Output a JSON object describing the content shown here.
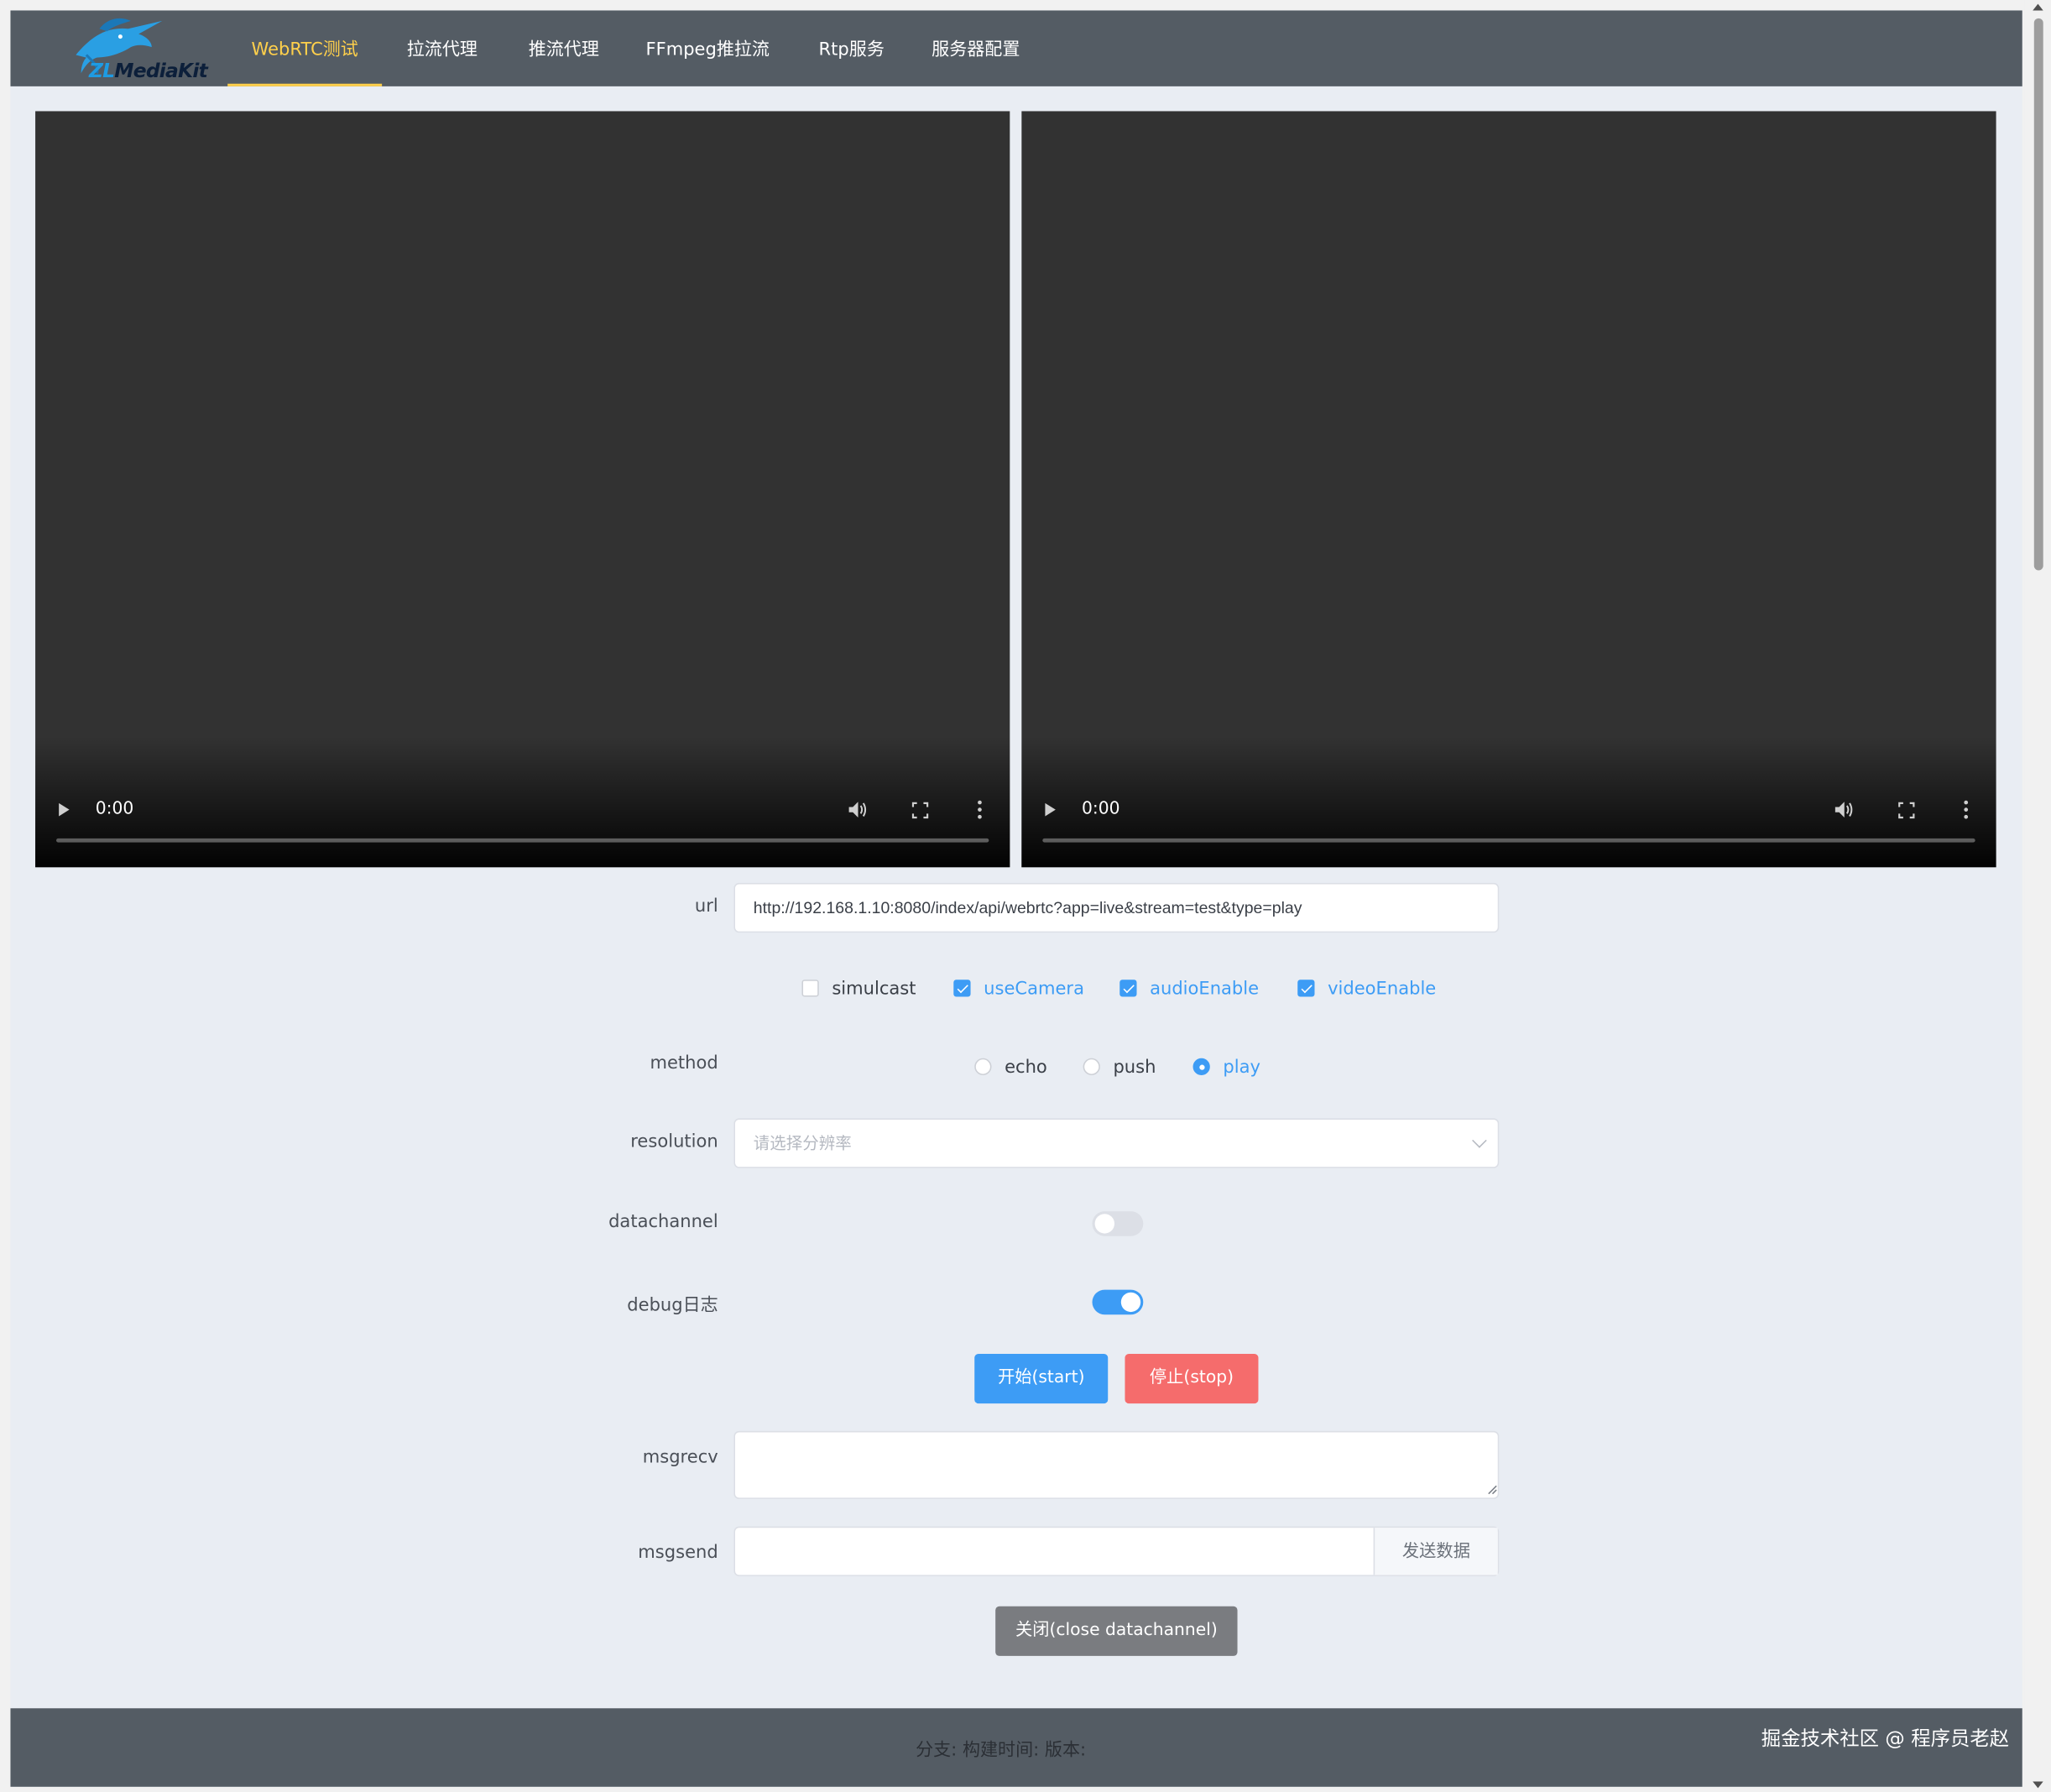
{
  "header": {
    "logo_text_prefix": "ZL",
    "logo_text_suffix": "MediaKit",
    "nav": [
      {
        "label": "WebRTC测试",
        "active": true
      },
      {
        "label": "拉流代理",
        "active": false
      },
      {
        "label": "推流代理",
        "active": false
      },
      {
        "label": "FFmpeg推拉流",
        "active": false
      },
      {
        "label": "Rtp服务",
        "active": false
      },
      {
        "label": "服务器配置",
        "active": false
      }
    ]
  },
  "videos": [
    {
      "time": "0:00"
    },
    {
      "time": "0:00"
    }
  ],
  "form": {
    "url_label": "url",
    "url_value": "http://192.168.1.10:8080/index/api/webrtc?app=live&stream=test&type=play",
    "checkboxes": [
      {
        "label": "simulcast",
        "checked": false
      },
      {
        "label": "useCamera",
        "checked": true
      },
      {
        "label": "audioEnable",
        "checked": true
      },
      {
        "label": "videoEnable",
        "checked": true
      }
    ],
    "method_label": "method",
    "methods": [
      {
        "label": "echo",
        "selected": false
      },
      {
        "label": "push",
        "selected": false
      },
      {
        "label": "play",
        "selected": true
      }
    ],
    "resolution_label": "resolution",
    "resolution_placeholder": "请选择分辨率",
    "datachannel_label": "datachannel",
    "datachannel_on": false,
    "debug_label": "debug日志",
    "debug_on": true,
    "start_button": "开始(start)",
    "stop_button": "停止(stop)",
    "msgrecv_label": "msgrecv",
    "msgrecv_value": "",
    "msgsend_label": "msgsend",
    "msgsend_value": "",
    "send_button": "发送数据",
    "close_button": "关闭(close datachannel)"
  },
  "footer": {
    "info": "分支: 构建时间: 版本:",
    "credit": "掘金技术社区 @ 程序员老赵"
  },
  "colors": {
    "nav_bg": "#545c64",
    "nav_active": "#ffd04b",
    "primary": "#3d9cf5",
    "danger": "#f56c6c",
    "close_button": "#7a7c80",
    "page_bg": "#e9edf3"
  }
}
